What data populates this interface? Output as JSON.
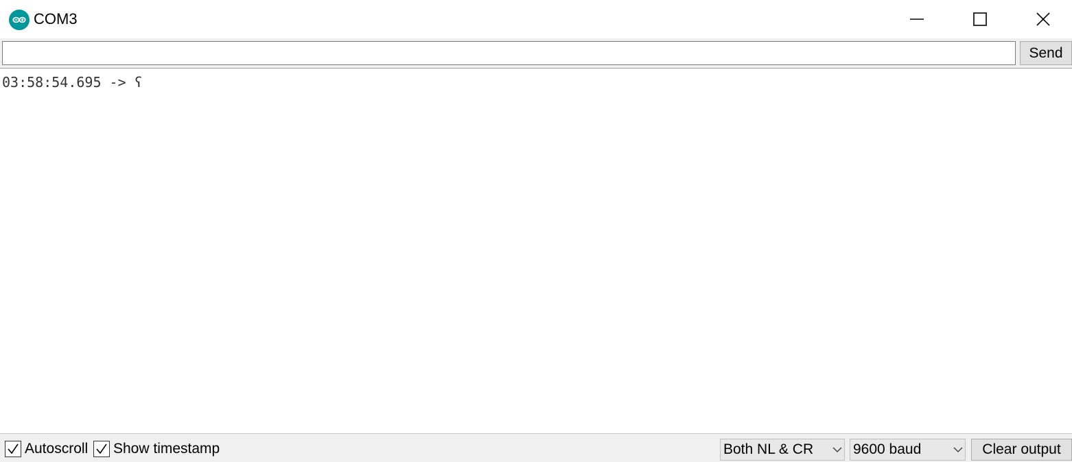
{
  "window": {
    "title": "COM3",
    "app_icon": "arduino-logo-icon",
    "controls": [
      "minimize-icon",
      "maximize-icon",
      "close-icon"
    ]
  },
  "send_row": {
    "input_value": "",
    "send_label": "Send"
  },
  "output": {
    "lines": [
      "03:58:54.695 -> ʕ"
    ]
  },
  "status_bar": {
    "autoscroll": {
      "label": "Autoscroll",
      "checked": true
    },
    "show_timestamp": {
      "label": "Show timestamp",
      "checked": true
    },
    "line_ending": {
      "selected": "Both NL & CR"
    },
    "baud_rate": {
      "selected": "9600 baud"
    },
    "clear_label": "Clear output"
  },
  "colors": {
    "accent": "#00979c",
    "bar_background": "#f0f0f0",
    "button_background": "#e1e1e1"
  }
}
